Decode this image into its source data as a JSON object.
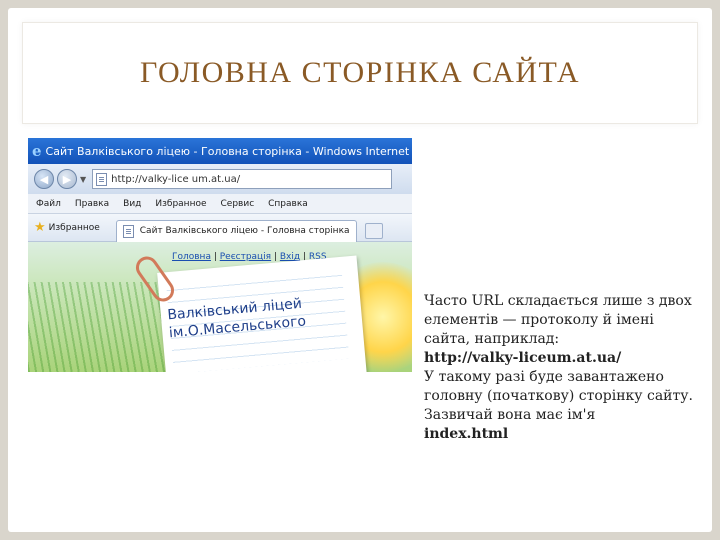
{
  "slide": {
    "title": "ГОЛОВНА СТОРІНКА САЙТА",
    "body_paragraphs": [
      "Часто URL складається лише з двох елементів — протоколу й імені сайта, наприклад:",
      "http://valky-liceum.at.ua/",
      "У такому разі буде завантажено головну (початкову) сторінку сайту.",
      "Зазвичай вона має ім'я",
      "index.html"
    ]
  },
  "browser": {
    "window_title": "Сайт Валківського ліцею - Головна сторінка - Windows Internet Ex",
    "address": "http://valky-lice um.at.ua/",
    "menu": [
      "Файл",
      "Правка",
      "Вид",
      "Избранное",
      "Сервис",
      "Справка"
    ],
    "favorites_label": "Избранное",
    "tab_title": "Сайт Валківського ліцею - Головна сторінка",
    "page_links": [
      "Головна",
      "Реєстрація",
      "Вхід",
      "RSS"
    ],
    "page_heading_line1": "Валківський ліцей",
    "page_heading_line2": "ім.О.Масельського"
  },
  "colors": {
    "title_color": "#8a5a26",
    "frame": "#d9d5cc",
    "ie_titlebar": "#1a5fc8"
  },
  "icons": {
    "ie": "ie-logo-icon",
    "back": "back-arrow-icon",
    "forward": "forward-arrow-icon",
    "page": "page-icon",
    "favorites": "star-icon"
  }
}
